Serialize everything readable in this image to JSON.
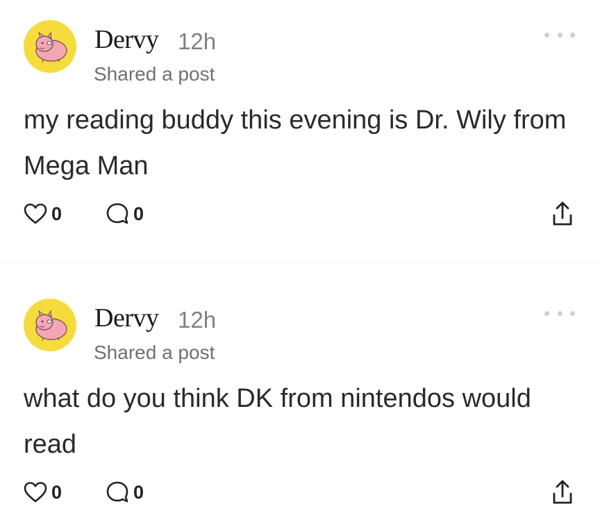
{
  "posts": [
    {
      "author": "Dervy",
      "time": "12h",
      "subtitle": "Shared a post",
      "text": "my reading buddy this evening is Dr. Wily from Mega Man",
      "likes": "0",
      "comments": "0"
    },
    {
      "author": "Dervy",
      "time": "12h",
      "subtitle": "Shared a post",
      "text": "what do you think DK from nintendos would read",
      "likes": "0",
      "comments": "0"
    }
  ],
  "icons": {
    "avatar": "pink-pig-avatar",
    "more": "more-horizontal-icon",
    "like": "heart-icon",
    "comment": "comment-icon",
    "share": "share-icon"
  },
  "colors": {
    "avatar_bg": "#f5dc3c",
    "pig": "#f4a6b4",
    "muted_text": "#808080"
  }
}
